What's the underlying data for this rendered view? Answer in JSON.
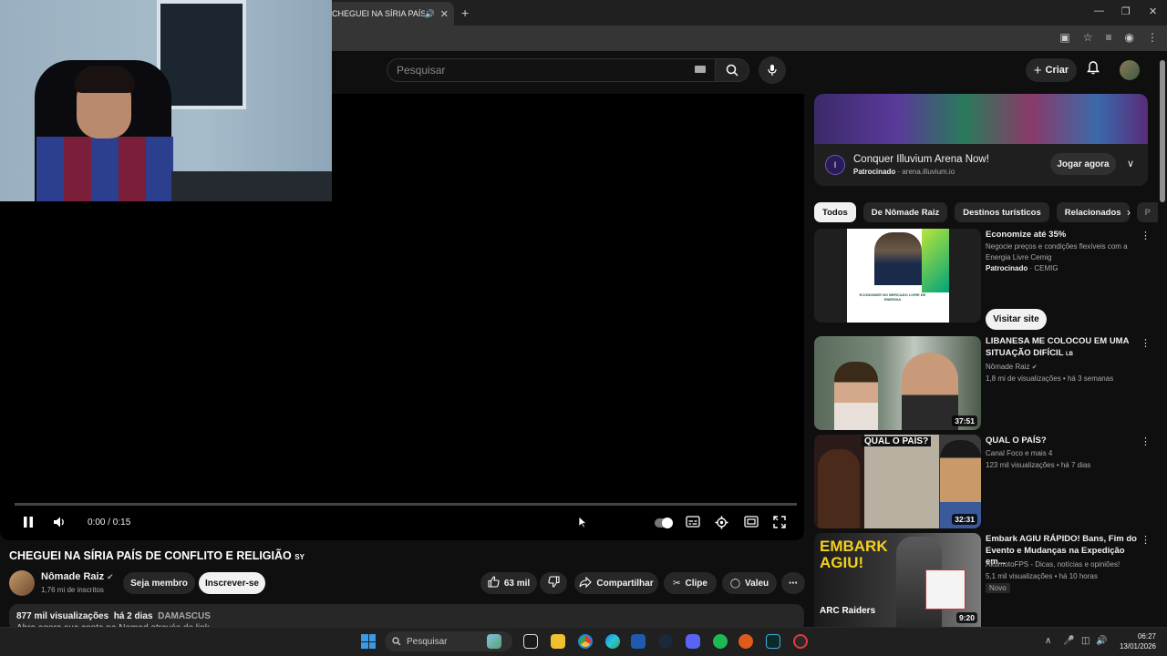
{
  "browser": {
    "tab_title": "CHEGUEI NA SÍRIA PAÍS DE",
    "tab_audio_icon": "speaker-icon",
    "new_tab_label": "+"
  },
  "header": {
    "search_placeholder": "Pesquisar",
    "create_label": "Criar"
  },
  "player": {
    "time": "0:00 / 0:15",
    "progress": 0
  },
  "video": {
    "title": "CHEGUEI NA SÍRIA PAÍS DE CONFLITO E RELIGIÃO",
    "title_tag": "SY",
    "channel": "Nômade Raiz",
    "subscribers": "1,76 mi de inscritos",
    "join_label": "Seja membro",
    "subscribe_label": "Inscrever-se",
    "likes": "63 mil",
    "share_label": "Compartilhar",
    "clip_label": "Clipe",
    "thanks_label": "Valeu",
    "views": "877 mil visualizações",
    "age": "há 2 dias",
    "location_tag": "DAMASCUS",
    "description_peek": "Abra agora sua conta na Nomad através do link"
  },
  "sidebar_ad": {
    "title": "Conquer Illuvium Arena Now!",
    "sponsored": "Patrocinado",
    "domain": "arena.illuvium.io",
    "cta": "Jogar agora",
    "logo_letter": "I"
  },
  "chips": [
    "Todos",
    "De Nômade Raiz",
    "Destinos turísticos",
    "Relacionados",
    "P"
  ],
  "recommendations": [
    {
      "title": "Economize até 35%",
      "line2": "Negocie preços e condições flexíveis com a Energia Livre Cemig",
      "sponsored": "Patrocinado",
      "advertiser": "CEMIG",
      "cta": "Visitar site",
      "thumb_text": "ECONOMIZE NO MERCADO LIVRE DE ENERGIA"
    },
    {
      "title": "LIBANESA ME COLOCOU EM UMA SITUAÇÃO DIFÍCIL",
      "title_tag": "LB",
      "channel": "Nômade Raiz",
      "stats": "1,8 mi de visualizações • há 3 semanas",
      "duration": "37:51"
    },
    {
      "title": "QUAL O PAÍS?",
      "channel": "Canal Foco e mais 4",
      "stats": "123 mil visualizações • há 7 dias",
      "duration": "32:31",
      "thumb_text": "QUAL O PAÍS?"
    },
    {
      "title": "Embark AGIU RÁPIDO! Bans, Fim do Evento e Mudanças na Expedição em...",
      "channel": "AkumotoFPS - Dicas, notícias e opiniões!",
      "stats": "5,1 mil visualizações • há 10 horas",
      "badge": "Novo",
      "duration": "9:20",
      "thumb_text": "EMBARK AGIU!",
      "thumb_text2": "ARC Raiders"
    }
  ],
  "taskbar": {
    "search_placeholder": "Pesquisar",
    "time": "06:27",
    "date": "13/01/2026"
  },
  "colors": {
    "background": "#0f0f0f",
    "chip_active": "#f1f1f1",
    "subscribe_bg": "#f1f1f1",
    "accent_blue": "#3ea6ff"
  }
}
